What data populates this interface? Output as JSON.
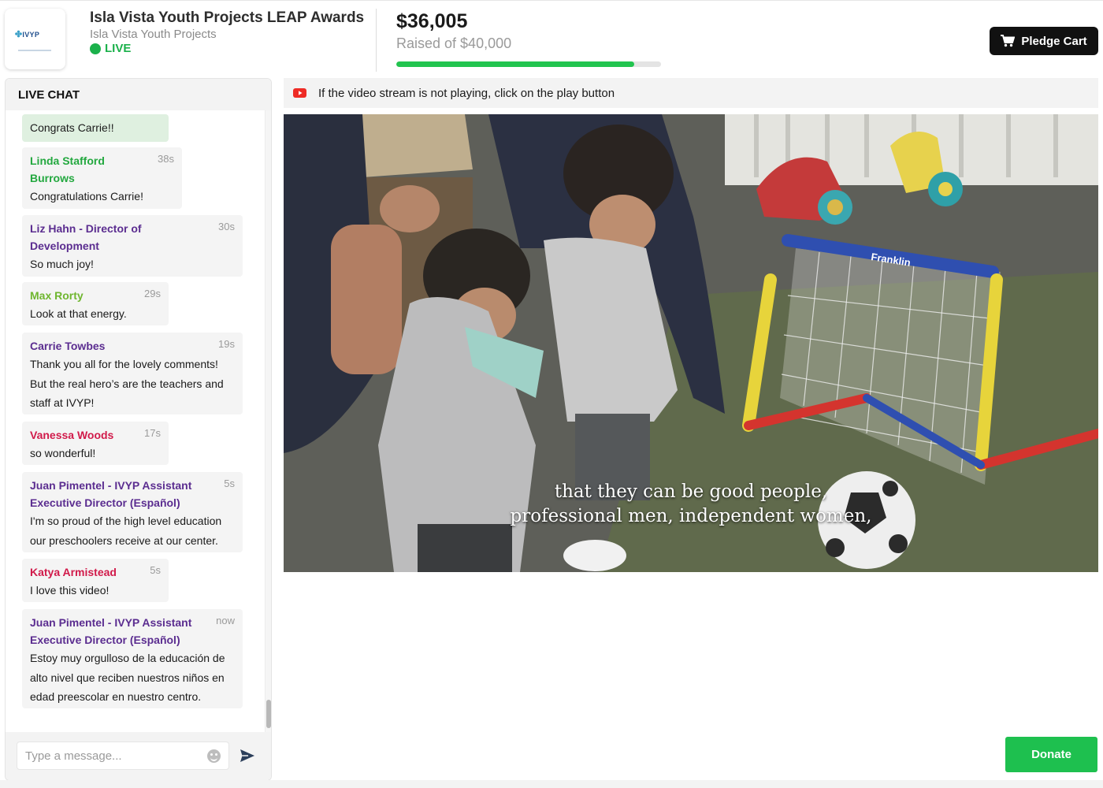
{
  "header": {
    "logo_text": "IVYP",
    "event_title": "Isla Vista Youth Projects LEAP Awards",
    "org_name": "Isla Vista Youth Projects",
    "live_label": "LIVE",
    "raised_amount": "$36,005",
    "raised_goal": "Raised of $40,000",
    "progress_fraction": 0.9,
    "pledge_cart_label": "Pledge Cart",
    "accent_green": "#1bb14b"
  },
  "chat": {
    "title": "LIVE CHAT",
    "input_placeholder": "Type a message...",
    "messages": [
      {
        "name": "",
        "time": "",
        "lines": [
          "Congrats Carrie!!"
        ],
        "color": ""
      },
      {
        "name": "Linda Stafford Burrows",
        "name_lines": [
          "Linda Stafford",
          "Burrows"
        ],
        "time": "38s",
        "lines": [
          "Congratulations Carrie!"
        ],
        "color": "#23a83f"
      },
      {
        "name": "Liz Hahn - Director of Development",
        "name_lines": [
          "Liz Hahn - Director of",
          "Development"
        ],
        "time": "30s",
        "lines": [
          "So much joy!"
        ],
        "color": "#5b2d90"
      },
      {
        "name": "Max Rorty",
        "name_lines": [
          "Max Rorty"
        ],
        "time": "29s",
        "lines": [
          "Look at that energy."
        ],
        "color": "#6fb62f"
      },
      {
        "name": "Carrie Towbes",
        "name_lines": [
          "Carrie Towbes"
        ],
        "time": "19s",
        "lines": [
          "Thank you all for the lovely comments!",
          "But the real hero’s are the teachers and",
          "staff at IVYP!"
        ],
        "color": "#5b2d90"
      },
      {
        "name": "Vanessa Woods",
        "name_lines": [
          "Vanessa Woods"
        ],
        "time": "17s",
        "lines": [
          "so wonderful!"
        ],
        "color": "#d11a4a"
      },
      {
        "name": "Juan Pimentel - IVYP Assistant Executive Director (Español)",
        "name_lines": [
          "Juan Pimentel - IVYP Assistant",
          "Executive Director (Español)"
        ],
        "time": "5s",
        "lines": [
          "I'm so proud of the high level education",
          "our preschoolers receive at our center."
        ],
        "color": "#5b2d90"
      },
      {
        "name": "Katya Armistead",
        "name_lines": [
          "Katya Armistead"
        ],
        "time": "5s",
        "lines": [
          "I love this video!"
        ],
        "color": "#d11a4a"
      },
      {
        "name": "Juan Pimentel - IVYP Assistant Executive Director (Español)",
        "name_lines": [
          "Juan Pimentel - IVYP Assistant",
          "Executive Director (Español)"
        ],
        "time": "now",
        "lines": [
          "Estoy muy orgulloso de la educación de",
          "alto nivel que reciben nuestros niños en",
          "edad preescolar en nuestro centro."
        ],
        "color": "#5b2d90"
      }
    ]
  },
  "stream": {
    "notice": "If the video stream is not playing, click on the play button",
    "caption_lines": [
      "that they can be good people,",
      "professional men, independent women,"
    ],
    "goal_brand": "Franklin"
  },
  "donate_label": "Donate"
}
